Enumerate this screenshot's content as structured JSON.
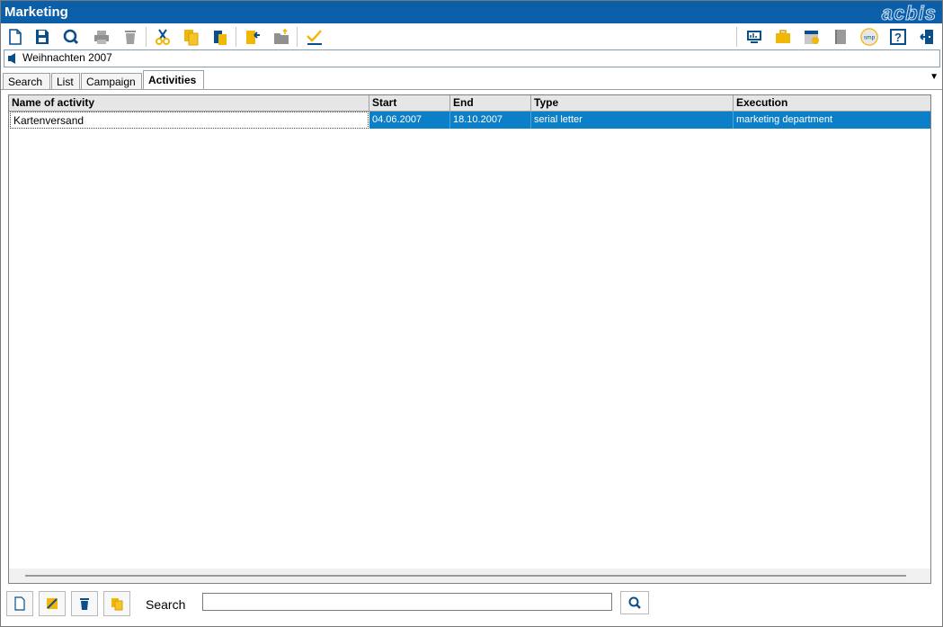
{
  "window": {
    "title": "Marketing",
    "logo": "acbis"
  },
  "toolbar": {
    "left": [
      "new-document-icon",
      "save-icon",
      "search-icon",
      "print-icon",
      "delete-icon",
      "cut-icon",
      "copy-icon",
      "paste-icon",
      "import-icon",
      "open-folder-icon",
      "chart-icon"
    ],
    "right": [
      "monitor-icon",
      "briefcase-icon",
      "calendar-check-icon",
      "book-icon",
      "smp-icon",
      "help-icon",
      "exit-icon"
    ],
    "smp_label": "smp",
    "help_label": "?"
  },
  "record": {
    "name": "Weihnachten 2007"
  },
  "tabs": [
    {
      "label": "Search"
    },
    {
      "label": "List"
    },
    {
      "label": "Campaign"
    },
    {
      "label": "Activities",
      "active": true
    }
  ],
  "table": {
    "columns": [
      "Name of activity",
      "Start",
      "End",
      "Type",
      "Execution"
    ],
    "rows": [
      {
        "name": "Kartenversand",
        "start": "04.06.2007",
        "end": "18.10.2007",
        "type": "serial letter",
        "execution": "marketing department"
      }
    ]
  },
  "bottom": {
    "buttons": [
      "new-icon",
      "edit-icon",
      "delete-icon",
      "copy-icon"
    ],
    "search_label": "Search",
    "search_value": "",
    "search_placeholder": ""
  },
  "colors": {
    "titlebar": "#0b5ea8",
    "selection": "#0b7fc7",
    "accent_yellow": "#f2b705"
  }
}
